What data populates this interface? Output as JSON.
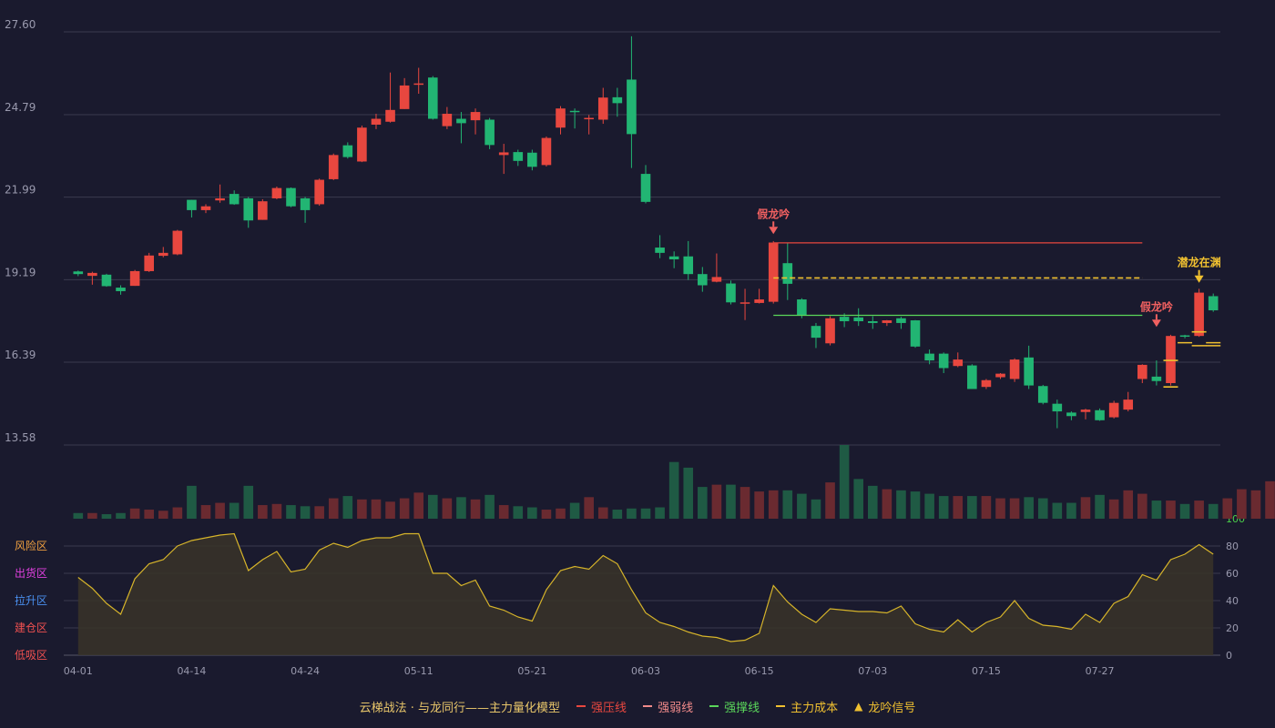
{
  "colors": {
    "background": "#1a1a2e",
    "up": "#e8473f",
    "down": "#22b573",
    "up_volume": "#6a2a30",
    "down_volume": "#1f5a44",
    "grid": "#3a3a4e",
    "axis_text": "#9a9aae",
    "pressure": "#e8473f",
    "weak": "#f08a8a",
    "support": "#5ad65a",
    "cost": "#f0c030",
    "signal_false": "#f06060",
    "signal_true": "#f0c030",
    "oscillator": "#d6b42a"
  },
  "chart_data": {
    "type": "candlestick",
    "price_axis": {
      "ticks": [
        13.58,
        16.39,
        19.19,
        21.99,
        24.79,
        27.6
      ],
      "range": [
        13.58,
        27.6
      ]
    },
    "date_ticks": [
      "04-01",
      "04-14",
      "04-24",
      "05-11",
      "05-21",
      "06-03",
      "06-15",
      "07-03",
      "07-15",
      "07-27"
    ],
    "date_tick_index": [
      0,
      8,
      16,
      24,
      32,
      40,
      48,
      56,
      64,
      72
    ],
    "candles": [
      [
        19.47,
        19.38,
        19.5,
        19.31
      ],
      [
        19.32,
        19.42,
        19.46,
        19.02
      ],
      [
        19.36,
        18.97,
        19.39,
        18.95
      ],
      [
        18.92,
        18.8,
        19.0,
        18.68
      ],
      [
        18.98,
        19.48,
        19.52,
        18.98
      ],
      [
        19.48,
        20.01,
        20.1,
        19.45
      ],
      [
        20.0,
        20.1,
        20.3,
        19.95
      ],
      [
        20.05,
        20.85,
        20.88,
        20.02
      ],
      [
        21.9,
        21.55,
        21.9,
        21.3
      ],
      [
        21.55,
        21.68,
        21.75,
        21.45
      ],
      [
        21.88,
        21.95,
        22.42,
        21.8
      ],
      [
        22.1,
        21.75,
        22.22,
        21.73
      ],
      [
        21.95,
        21.2,
        22.0,
        20.95
      ],
      [
        21.22,
        21.85,
        21.92,
        21.22
      ],
      [
        21.95,
        22.3,
        22.35,
        21.92
      ],
      [
        22.3,
        21.68,
        22.32,
        21.65
      ],
      [
        21.95,
        21.55,
        22.0,
        21.12
      ],
      [
        21.75,
        22.58,
        22.62,
        21.7
      ],
      [
        22.6,
        23.42,
        23.47,
        22.57
      ],
      [
        23.75,
        23.35,
        23.85,
        23.3
      ],
      [
        23.2,
        24.35,
        24.42,
        23.18
      ],
      [
        24.45,
        24.65,
        24.82,
        24.3
      ],
      [
        24.55,
        24.95,
        26.22,
        24.52
      ],
      [
        24.98,
        25.78,
        26.03,
        24.98
      ],
      [
        25.85,
        25.85,
        26.38,
        25.5
      ],
      [
        26.05,
        24.65,
        26.1,
        24.62
      ],
      [
        24.4,
        24.82,
        25.05,
        24.3
      ],
      [
        24.65,
        24.5,
        24.88,
        23.82
      ],
      [
        24.6,
        24.88,
        25.0,
        24.12
      ],
      [
        24.62,
        23.76,
        24.68,
        23.62
      ],
      [
        23.42,
        23.51,
        23.8,
        22.78
      ],
      [
        23.52,
        23.22,
        23.6,
        23.05
      ],
      [
        23.5,
        23.02,
        23.6,
        22.9
      ],
      [
        23.08,
        24.0,
        24.05,
        23.03
      ],
      [
        24.35,
        25.0,
        25.08,
        24.12
      ],
      [
        24.92,
        24.88,
        25.0,
        24.32
      ],
      [
        24.65,
        24.68,
        24.78,
        24.12
      ],
      [
        24.62,
        25.37,
        25.7,
        24.48
      ],
      [
        25.38,
        25.18,
        25.7,
        24.72
      ],
      [
        25.98,
        24.13,
        27.45,
        22.98
      ],
      [
        22.78,
        21.83,
        23.08,
        21.78
      ],
      [
        20.28,
        20.1,
        20.7,
        19.92
      ],
      [
        19.98,
        19.88,
        20.15,
        19.58
      ],
      [
        19.98,
        19.38,
        20.5,
        19.18
      ],
      [
        19.38,
        19.0,
        19.62,
        18.78
      ],
      [
        19.12,
        19.28,
        20.08,
        19.1
      ],
      [
        19.06,
        18.42,
        19.16,
        18.35
      ],
      [
        18.42,
        18.42,
        18.88,
        17.82
      ],
      [
        18.4,
        18.52,
        18.88,
        18.38
      ],
      [
        18.44,
        20.45,
        20.5,
        18.38
      ],
      [
        19.75,
        19.05,
        20.42,
        18.5
      ],
      [
        18.52,
        17.98,
        18.56,
        17.88
      ],
      [
        17.62,
        17.22,
        17.72,
        16.87
      ],
      [
        17.03,
        17.88,
        17.95,
        16.96
      ],
      [
        17.93,
        17.78,
        18.05,
        17.58
      ],
      [
        17.91,
        17.78,
        18.22,
        17.62
      ],
      [
        17.78,
        17.72,
        17.95,
        17.52
      ],
      [
        17.72,
        17.81,
        17.82,
        17.62
      ],
      [
        17.88,
        17.72,
        17.93,
        17.52
      ],
      [
        17.81,
        16.92,
        17.82,
        16.88
      ],
      [
        16.68,
        16.45,
        16.82,
        16.32
      ],
      [
        16.68,
        16.19,
        16.72,
        16.02
      ],
      [
        16.26,
        16.48,
        16.72,
        16.22
      ],
      [
        16.28,
        15.48,
        16.32,
        15.48
      ],
      [
        15.55,
        15.78,
        15.82,
        15.48
      ],
      [
        15.88,
        16.0,
        16.02,
        15.82
      ],
      [
        15.82,
        16.48,
        16.52,
        15.72
      ],
      [
        16.55,
        15.6,
        16.95,
        15.48
      ],
      [
        15.58,
        15.01,
        15.62,
        14.96
      ],
      [
        14.98,
        14.72,
        15.12,
        14.15
      ],
      [
        14.68,
        14.56,
        14.72,
        14.42
      ],
      [
        14.7,
        14.78,
        14.81,
        14.45
      ],
      [
        14.76,
        14.42,
        14.82,
        14.4
      ],
      [
        14.52,
        15.01,
        15.08,
        14.48
      ],
      [
        14.78,
        15.12,
        15.38,
        14.72
      ],
      [
        15.82,
        16.3,
        16.32,
        15.68
      ],
      [
        15.9,
        15.75,
        16.45,
        15.6
      ],
      [
        15.68,
        17.28,
        17.32,
        15.6
      ],
      [
        17.3,
        17.26,
        17.32,
        17.2
      ],
      [
        17.28,
        18.75,
        18.88,
        17.25
      ],
      [
        18.63,
        18.15,
        18.72,
        18.1
      ]
    ],
    "volume": [
      5,
      5,
      4,
      5,
      9,
      8,
      7,
      10,
      29,
      12,
      14,
      14,
      29,
      12,
      13,
      12,
      11,
      11,
      18,
      20,
      17,
      17,
      15,
      18,
      23,
      21,
      18,
      19,
      17,
      21,
      12,
      11,
      10,
      8,
      9,
      14,
      19,
      10,
      8,
      9,
      9,
      10,
      50,
      45,
      28,
      30,
      30,
      28,
      24,
      25,
      25,
      22,
      17,
      32,
      65,
      35,
      29,
      26,
      25,
      24,
      22,
      20,
      20,
      20,
      20,
      18,
      18,
      19,
      18,
      14,
      14,
      19,
      21,
      17,
      25,
      22,
      16,
      16,
      13,
      16,
      13,
      18,
      26,
      25,
      33,
      49,
      48,
      48
    ],
    "lines": {
      "pressure_line": {
        "price": 20.44,
        "from_index": 49,
        "to_index": 75
      },
      "support_line": {
        "price": 17.98,
        "from_index": 49,
        "to_index": 75
      },
      "cost_line": {
        "price": 19.25,
        "from_index": 49,
        "to_index": 75
      },
      "cost_ticks": [
        {
          "index": 77,
          "price": 16.45
        },
        {
          "index": 77,
          "price": 15.55
        },
        {
          "index": 78,
          "price": 17.05
        },
        {
          "index": 79,
          "price": 17.42
        },
        {
          "index": 79,
          "price": 16.95
        },
        {
          "index": 80,
          "price": 17.05
        },
        {
          "index": 80,
          "price": 16.95
        }
      ]
    },
    "signals": [
      {
        "index": 49,
        "label": "假龙吟",
        "kind": "false",
        "price": 20.55
      },
      {
        "index": 76,
        "label": "假龙吟",
        "kind": "false",
        "price": 17.4
      },
      {
        "index": 79,
        "label": "潜龙在渊",
        "kind": "true",
        "price": 18.9
      }
    ],
    "oscillator": {
      "range": [
        0,
        100
      ],
      "ticks": [
        0,
        20,
        40,
        60,
        80,
        100
      ],
      "zones": [
        {
          "label": "风险区",
          "value": 80,
          "color": "#f0a040"
        },
        {
          "label": "出货区",
          "value": 60,
          "color": "#e040e0"
        },
        {
          "label": "拉升区",
          "value": 40,
          "color": "#4a90f0"
        },
        {
          "label": "建仓区",
          "value": 20,
          "color": "#f05050"
        },
        {
          "label": "低吸区",
          "value": 0,
          "color": "#f05050"
        }
      ],
      "values": [
        57,
        49,
        38,
        30,
        56,
        67,
        70,
        80,
        84,
        86,
        88,
        89,
        62,
        70,
        76,
        61,
        63,
        77,
        82,
        79,
        84,
        86,
        86,
        89,
        89,
        60,
        60,
        51,
        55,
        36,
        33,
        28,
        25,
        48,
        62,
        65,
        63,
        73,
        67,
        48,
        31,
        24,
        21,
        17,
        14,
        13,
        10,
        11,
        16,
        51,
        39,
        30,
        24,
        34,
        33,
        32,
        32,
        31,
        36,
        23,
        19,
        17,
        26,
        17,
        24,
        28,
        40,
        27,
        22,
        21,
        19,
        30,
        24,
        38,
        43,
        59,
        55,
        70,
        74,
        81,
        74
      ]
    }
  },
  "legend": {
    "title": "云梯战法 · 与龙同行——主力量化模型",
    "items": [
      {
        "label": "强压线",
        "color": "#e8473f",
        "style": "solid"
      },
      {
        "label": "强弱线",
        "color": "#f08a8a",
        "style": "dashed"
      },
      {
        "label": "强撑线",
        "color": "#5ad65a",
        "style": "solid"
      },
      {
        "label": "主力成本",
        "color": "#f0c030",
        "style": "dashed"
      },
      {
        "label": "龙吟信号",
        "color": "#f0c030",
        "style": "triangle"
      }
    ]
  }
}
